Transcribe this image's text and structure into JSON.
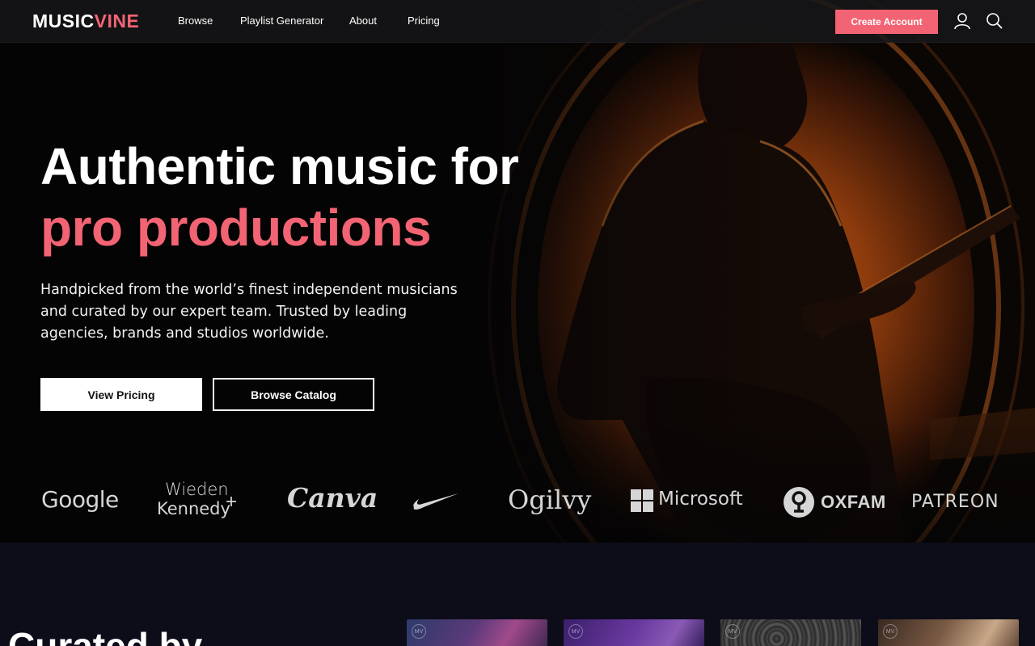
{
  "nav": {
    "logo_part1": "MUSIC",
    "logo_part2": "VINE",
    "links": [
      "Browse",
      "Playlist Generator",
      "About",
      "Pricing"
    ],
    "cta_label": "Create Account",
    "icons": [
      "user-icon",
      "search-icon"
    ]
  },
  "hero": {
    "title_line1": "Authentic music for",
    "title_line2": "pro productions",
    "lead": "Handpicked from the world’s finest independent musicians and curated by our expert team. Trusted by leading agencies, brands and studios worldwide.",
    "primary_button": "View Pricing",
    "secondary_button": "Browse Catalog"
  },
  "brands": {
    "google": "Google",
    "wieden_line1": "Wieden",
    "wieden_line2": "Kennedy",
    "wieden_plus": "+",
    "canva": "Canva",
    "ogilvy": "Ogilvy",
    "microsoft": "Microsoft",
    "oxfam": "OXFAM",
    "patreon": "PATREON"
  },
  "section": {
    "heading": "Curated by"
  },
  "thumbnails": [
    {
      "mark": "MV"
    },
    {
      "mark": "MV"
    },
    {
      "mark": "MV"
    },
    {
      "mark": "MV"
    }
  ],
  "colors": {
    "accent": "#f26473",
    "nav_bg": "#161618",
    "section_bg": "#0d0d1a"
  }
}
